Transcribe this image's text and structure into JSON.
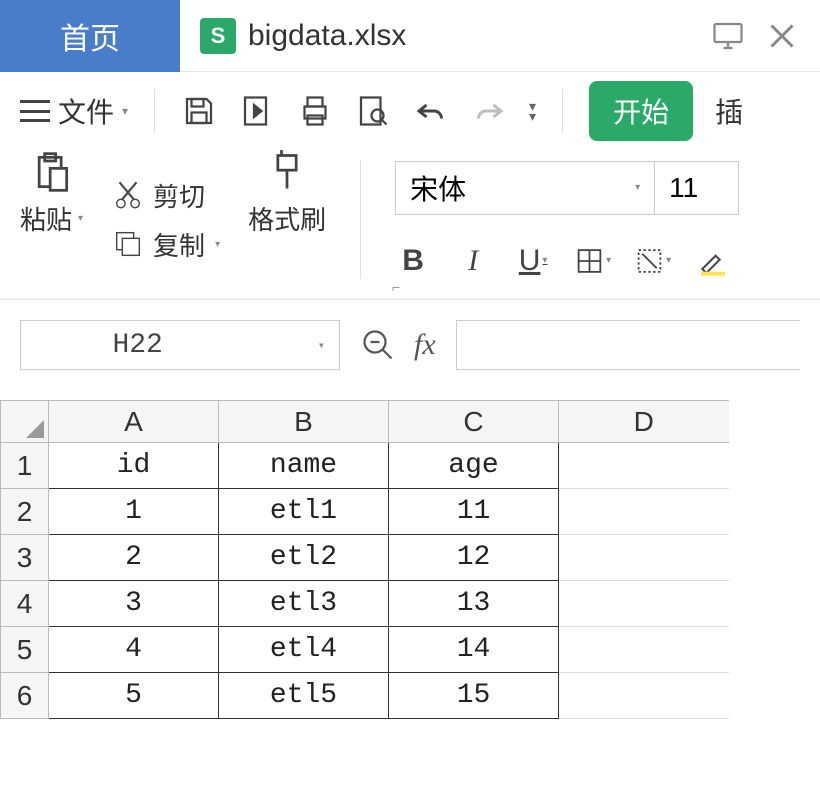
{
  "tabs": {
    "home": "首页",
    "file_icon_letter": "S",
    "file_name": "bigdata.xlsx"
  },
  "toolbar": {
    "file_menu": "文件",
    "start": "开始",
    "insert": "插",
    "paste": "粘贴",
    "cut": "剪切",
    "copy": "复制",
    "format_painter": "格式刷"
  },
  "font": {
    "name": "宋体",
    "size": "11"
  },
  "cell_ref": "H22",
  "fx_label": "fx",
  "grid": {
    "col_headers": [
      "A",
      "B",
      "C",
      "D"
    ],
    "row_headers": [
      "1",
      "2",
      "3",
      "4",
      "5",
      "6"
    ],
    "rows": [
      {
        "A": "id",
        "B": "name",
        "C": "age",
        "D": ""
      },
      {
        "A": "1",
        "B": "etl1",
        "C": "11",
        "D": ""
      },
      {
        "A": "2",
        "B": "etl2",
        "C": "12",
        "D": ""
      },
      {
        "A": "3",
        "B": "etl3",
        "C": "13",
        "D": ""
      },
      {
        "A": "4",
        "B": "etl4",
        "C": "14",
        "D": ""
      },
      {
        "A": "5",
        "B": "etl5",
        "C": "15",
        "D": ""
      }
    ]
  }
}
